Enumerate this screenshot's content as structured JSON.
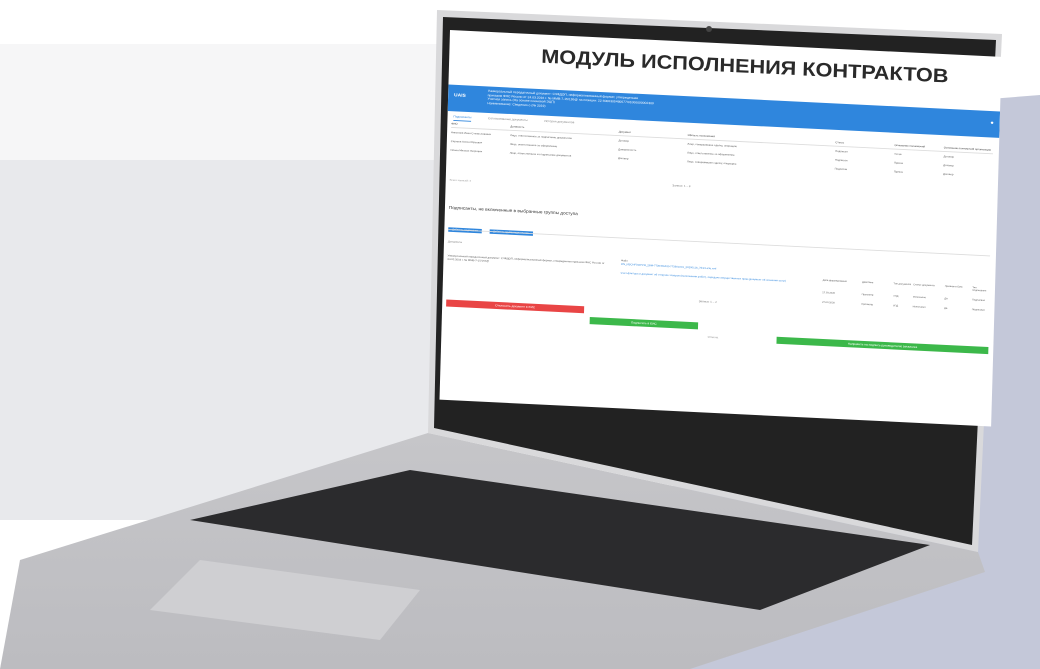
{
  "screen": {
    "title": "МОДУЛЬ ИСПОЛНЕНИЯ КОНТРАКТОВ",
    "app": {
      "logo": "UAIS",
      "info_lines": [
        "Универсальный передаточный документ: СЧФДОП, неформализованный формат, утвержденная",
        "приказом ФНС России от 24.03.2016 г. № ММВ-7-15/155@ на позиции: 22-6000305480077/01000000002300",
        "Учетная запись (На основе ключевой ЭЦП)",
        "Наименование: Сведения о (№ 2019)"
      ],
      "user_icon": "user-icon"
    },
    "tabs": [
      {
        "label": "Подписанты",
        "active": true
      },
      {
        "label": "Согласованные документы",
        "active": false
      },
      {
        "label": "История документов",
        "active": false
      }
    ],
    "signers_table": {
      "columns": [
        "ФИО",
        "Должность",
        "Документ",
        "Область полномочий",
        "Статус",
        "Основание полномочий",
        "Основание полномочий организации"
      ],
      "rows": [
        [
          "Николаев Иван Станиславович",
          "Лицо, ответственное за подписание документов",
          "Договор",
          "Лицо, совершившее сделку, операцию",
          "Подписан",
          "Устав",
          "Договор"
        ],
        [
          "Сергеев Антон Юрьевич",
          "Лицо, ответственное за оформление",
          "Доверенность",
          "Лицо, ответственное за оформление",
          "Подписан",
          "Приказ",
          "Договор"
        ],
        [
          "Ильин Михаил Петрович",
          "Лицо, ответственное за подписание документов",
          "Договор",
          "Лицо, совершившее сделку, операцию",
          "Подписан",
          "Приказ",
          "Договор"
        ]
      ],
      "pager": "Записи: 1 – 3",
      "total": "Всего записей: 3"
    },
    "section_title": "Подписанты, не включенные в выбранные группы доступа",
    "chips": [
      "Добавить подписанта",
      "Добавить группу подписантов"
    ],
    "documents": {
      "header": "Документы",
      "left_text": "Универсальный передаточный документ: СЧФДОП, неформализованный формат, утвержденная приказом ФНС России от 24.03.2016 г. № ММВ-7-15/155@",
      "mid_label": "Файл",
      "mid_links": [
        "ON_NSCHFDOPPR_2BM-7726356420-772601001_20200116_7d4c1a3e.xml",
        "Счет-фактура и документ об отгрузке товаров (выполнении работ), передаче имущественных прав (документ об оказании услуг)"
      ],
      "right_columns": [
        "Дата формирования",
        "Действие",
        "Тип документа",
        "Статус документа",
        "Признак в ЕИС",
        "Тип подписания"
      ],
      "right_rows": [
        [
          "27.03.2020",
          "Просмотр",
          "УПД",
          "Исполнено",
          "Да",
          "Подписано"
        ],
        [
          "27.03.2020",
          "Просмотр",
          "УПД",
          "Исполнено",
          "Да",
          "Подписано"
        ]
      ],
      "pager": "Записи: 1 – 2"
    },
    "buttons": {
      "reject": "Отклонить документ в ЕИС",
      "sign": "Подписать в ЕИС",
      "cancel": "Отмена",
      "send": "Направить на подпись руководителю заказчика"
    }
  }
}
